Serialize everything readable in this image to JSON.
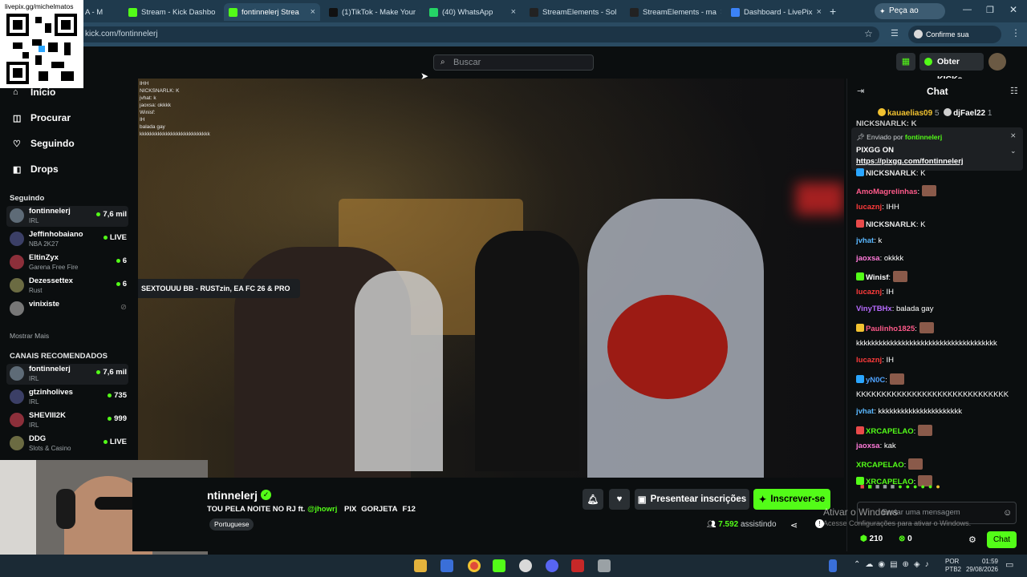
{
  "browser": {
    "tabs": [
      {
        "label": "Stream - Kick Dashbo",
        "icon": "kick-icon"
      },
      {
        "label": "fontinnelerj Strea",
        "icon": "kick-icon",
        "active": true
      },
      {
        "label": "(1)TikTok - Make Your",
        "icon": "tiktok-icon"
      },
      {
        "label": "(40) WhatsApp",
        "icon": "whatsapp-icon"
      },
      {
        "label": "StreamElements - Sol",
        "icon": "streamelements-icon"
      },
      {
        "label": "StreamElements - ma",
        "icon": "streamelements-icon"
      },
      {
        "label": "Dashboard - LivePix",
        "icon": "livepix-icon"
      }
    ],
    "first_tab_partial": "A - M",
    "gemini_button": "Peça ao Gemini",
    "url": "kick.com/fontinnelerj",
    "identity_button": "Confirme sua identidade"
  },
  "overlay_qr": {
    "text": "livepix.gg/michelmatos"
  },
  "kick": {
    "search_placeholder": "Buscar",
    "get_kicks": "Obter KICKs",
    "nav": [
      {
        "label": "Início",
        "icon": "home-icon"
      },
      {
        "label": "Procurar",
        "icon": "browse-icon"
      },
      {
        "label": "Seguindo",
        "icon": "heart-icon"
      },
      {
        "label": "Drops",
        "icon": "drops-icon"
      }
    ],
    "following_header": "Seguindo",
    "following": [
      {
        "name": "fontinnelerj",
        "category": "IRL",
        "count": "7,6 mil"
      },
      {
        "name": "Jeffinhobaiano",
        "category": "NBA 2K27",
        "count": "LIVE"
      },
      {
        "name": "EltinZyx",
        "category": "Garena Free Fire",
        "count": "6"
      },
      {
        "name": "Dezessettex",
        "category": "Rust",
        "count": "6"
      },
      {
        "name": "vinixiste",
        "category": "",
        "count": ""
      }
    ],
    "show_more": "Mostrar Mais",
    "recommended_header": "CANAIS RECOMENDADOS",
    "recommended": [
      {
        "name": "fontinnelerj",
        "category": "IRL",
        "count": "7,6 mil"
      },
      {
        "name": "gtzinholives",
        "category": "IRL",
        "count": "735"
      },
      {
        "name": "SHEVIII2K",
        "category": "IRL",
        "count": "999"
      },
      {
        "name": "DDG",
        "category": "Slots & Casino",
        "count": "LIVE"
      }
    ]
  },
  "video_overlay": {
    "mini_chat": [
      "IHH",
      "NICKSNARLK: K",
      "jvhat: k",
      "jaoxsa: okkkk",
      "Winisf: ",
      "IH",
      "balada gay",
      "kkkkkkkkkkkkkkkkkkkkkkkkkkk"
    ],
    "tooltip": "SEXTOUUU BB - RUSTzin, EA FC 26 & PRO"
  },
  "stream": {
    "channel": "ntinnelerj",
    "title": "TOU PELA NOITE NO RJ ft.",
    "mention": "@jhowrj",
    "tags_inline": [
      "PIX",
      "GORJETA",
      "F12"
    ],
    "language": "Portuguese",
    "gift_button": "Presentear inscrições",
    "subscribe_button": "Inscrever-se",
    "viewers": "7.592",
    "viewers_label": "assistindo"
  },
  "chat": {
    "title": "Chat",
    "top_gifters": [
      {
        "name": "kauaelias09",
        "count": "5"
      },
      {
        "name": "djFael22",
        "count": "1"
      }
    ],
    "pinned": {
      "sent_by": "Enviado por",
      "user": "fontinnelerj",
      "line1": "PIXGG ON",
      "link": "https://pixgg.com/fontinnelerj"
    },
    "partial_top": "NICKSNARLK: K",
    "messages": [
      {
        "user": "NICKSNARLK",
        "text": "K",
        "color": "#e6e6e6"
      },
      {
        "user": "AmoMagrelinhas",
        "text": "",
        "color": "#ff5a8a"
      },
      {
        "user": "lucaznj",
        "text": "IHH",
        "color": "#ff3b3b"
      },
      {
        "user": "NICKSNARLK",
        "text": "K",
        "color": "#e6e6e6"
      },
      {
        "user": "jvhat",
        "text": "k",
        "color": "#5ab8ff"
      },
      {
        "user": "jaoxsa",
        "text": "okkkk",
        "color": "#ff7ad9"
      },
      {
        "user": "Winisf",
        "text": "",
        "color": "#ffffff"
      },
      {
        "user": "lucaznj",
        "text": "IH",
        "color": "#ff3b3b"
      },
      {
        "user": "VinyTBHx",
        "text": "balada gay",
        "color": "#b86bff"
      },
      {
        "user": "Paulinho1825",
        "text": "",
        "color": "#ff5a8a"
      },
      {
        "user": "",
        "text": "kkkkkkkkkkkkkkkkkkkkkkkkkkkkkkkkkkkkk",
        "color": "#ffffff"
      },
      {
        "user": "lucaznj",
        "text": "IH",
        "color": "#ff3b3b"
      },
      {
        "user": "yN0C",
        "text": "",
        "color": "#4fa3ff"
      },
      {
        "user": "",
        "text": "KKKKKKKKKKKKKKKKKKKKKKKKKKKKKK",
        "color": "#ffffff"
      },
      {
        "user": "jvhat",
        "text": "kkkkkkkkkkkkkkkkkkkkkk",
        "color": "#5ab8ff"
      },
      {
        "user": "XRCAPELAO",
        "text": "",
        "color": "#53fc18"
      },
      {
        "user": "jaoxsa",
        "text": "kak",
        "color": "#ff7ad9"
      },
      {
        "user": "XRCAPELAO",
        "text": "",
        "color": "#53fc18"
      },
      {
        "user": "XRCAPELAO",
        "text": "",
        "color": "#53fc18"
      }
    ],
    "input_placeholder": "Enviar uma mensagem",
    "points": "210",
    "kicks": "0",
    "send_button": "Chat"
  },
  "windows_watermark": {
    "line1": "Ativar o Windows",
    "line2": "Acesse Configurações para ativar o Windows."
  },
  "taskbar": {
    "lang": "POR",
    "layout": "PTB2",
    "time": "01:59",
    "date": "29/08/2026"
  },
  "colors": {
    "kick_green": "#53fc18",
    "bg": "#0b0e0f",
    "browser": "#2a4b62"
  }
}
